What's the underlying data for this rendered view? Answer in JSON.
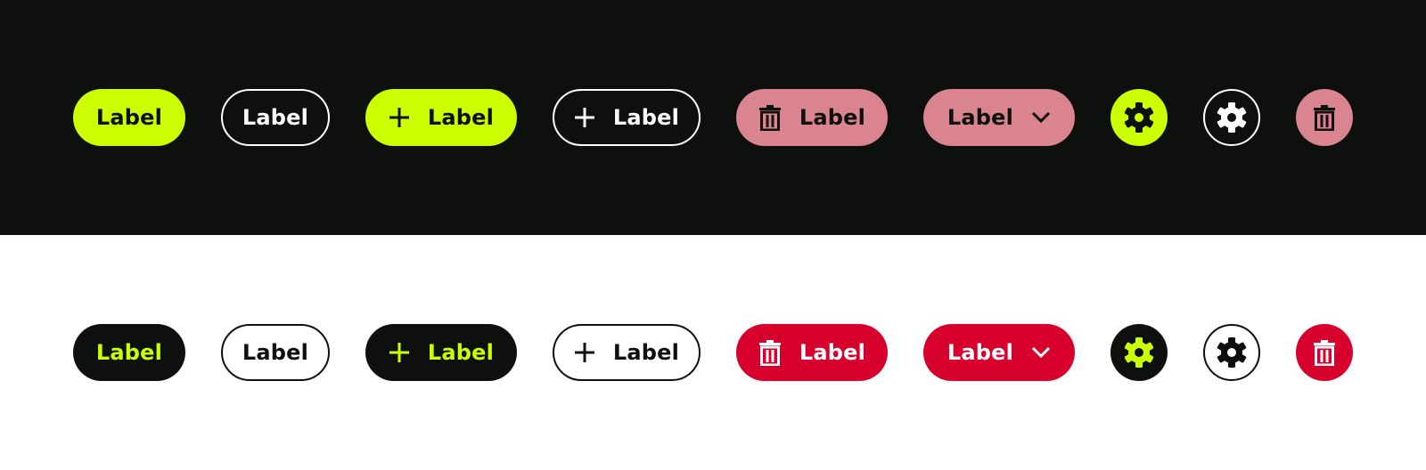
{
  "colors": {
    "dark_background": "#0e100d",
    "light_background": "#ffffff",
    "accent_lime": "#ccff00",
    "danger_soft": "#d9848f",
    "danger": "#d7002c",
    "text_dark": "#0e100d",
    "text_light": "#ffffff"
  },
  "dark_row": {
    "primary_label": "Label",
    "outline_label": "Label",
    "primary_add_label": "Label",
    "outline_add_label": "Label",
    "delete_label": "Label",
    "dropdown_label": "Label",
    "icons": [
      "plus-icon",
      "trash-icon",
      "chevron-down-icon",
      "gear-icon"
    ]
  },
  "light_row": {
    "primary_label": "Label",
    "outline_label": "Label",
    "primary_add_label": "Label",
    "outline_add_label": "Label",
    "delete_label": "Label",
    "dropdown_label": "Label",
    "icons": [
      "plus-icon",
      "trash-icon",
      "chevron-down-icon",
      "gear-icon"
    ]
  }
}
